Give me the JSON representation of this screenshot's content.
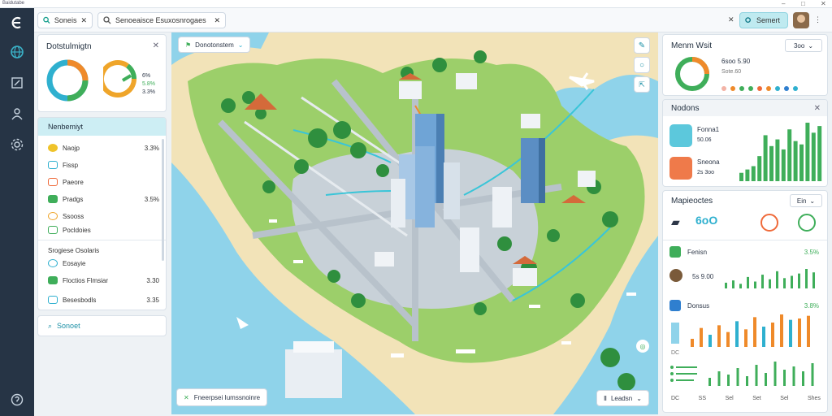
{
  "window": {
    "title": "Baidutabe",
    "min": "–",
    "max": "□",
    "close": "✕"
  },
  "colors": {
    "accent": "#3bb3c9",
    "rail": "#263445",
    "green": "#3fae5a",
    "orange": "#ef8a2a",
    "water": "#8fd3ea",
    "land": "#9ccf6a"
  },
  "rail": {
    "icons": [
      "logo-icon",
      "globe-icon",
      "layers-icon",
      "user-icon",
      "settings-icon"
    ],
    "bottom_icon": "help-icon"
  },
  "topbar": {
    "tab_label": "Soneis",
    "tab_close": "✕",
    "search_value": "Senoeaisce Esuxosnrogaes",
    "search_close": "✕",
    "close_x": "✕",
    "search_button": "Semert"
  },
  "left_panel": {
    "title": "Dotstulmigtn",
    "close": "✕",
    "donut_labels": [
      "6%",
      "5.8%",
      "3.3%"
    ],
    "section_header": "Nenbemiyt",
    "rows": [
      {
        "label": "Naojp",
        "value": "3.3%"
      },
      {
        "label": "Fissp",
        "value": ""
      },
      {
        "label": "Paeore",
        "value": ""
      },
      {
        "label": "Pradgs",
        "value": "3.5%"
      },
      {
        "label": "Ssooss",
        "value": ""
      },
      {
        "label": "Pocldoies",
        "value": ""
      }
    ],
    "group_rows": [
      {
        "label": "Srogiese Osolaris",
        "value": ""
      },
      {
        "label": "Eosayie",
        "value": ""
      },
      {
        "label": "Floctios Flmsiar",
        "value": "3.30"
      },
      {
        "label": "Besesbodls",
        "value": "3.35"
      }
    ],
    "footer_button": "Sonoet"
  },
  "map": {
    "location_chip": "Donotonstem",
    "layers_chip": "Fneerpsei Iumssnoinre",
    "zoom_chip": "Leadsn",
    "tools": [
      "pencil-icon",
      "search-icon",
      "export-icon"
    ]
  },
  "right_panel_top": {
    "title": "Menm Wsit",
    "dropdown": "3oo",
    "numbers": "6soo  5.90",
    "sub": "Sote.60"
  },
  "right_panel_models": {
    "title": "Nodons",
    "close": "✕",
    "items": [
      {
        "label": "Fonna1",
        "value": "50.06"
      },
      {
        "label": "Sneona",
        "value": "2s 3oo"
      }
    ],
    "bars": [
      10,
      14,
      18,
      30,
      55,
      42,
      50,
      38,
      62,
      48,
      44,
      70,
      58,
      66
    ]
  },
  "right_panel_map": {
    "title": "Mapieoctes",
    "dropdown": "Ein",
    "counter": "6oO",
    "rows": [
      {
        "label": "Fenisn",
        "value": "3.5%",
        "sub": "5s 9.00"
      },
      {
        "label": "Donsus",
        "value": "3.8%"
      }
    ],
    "chart_a": [
      10,
      14,
      8,
      20,
      12,
      24,
      16,
      30,
      18,
      22,
      26,
      34,
      28
    ],
    "chart_b": [
      12,
      28,
      18,
      32,
      22,
      38,
      26,
      44,
      30,
      36,
      48,
      40,
      42,
      46
    ],
    "chart_c": [
      10,
      18,
      14,
      22,
      12,
      26,
      16,
      30,
      20,
      24,
      18,
      28
    ],
    "axis_labels": [
      "DC",
      "SS",
      "Sel",
      "Set",
      "Sel",
      "Shes"
    ]
  }
}
